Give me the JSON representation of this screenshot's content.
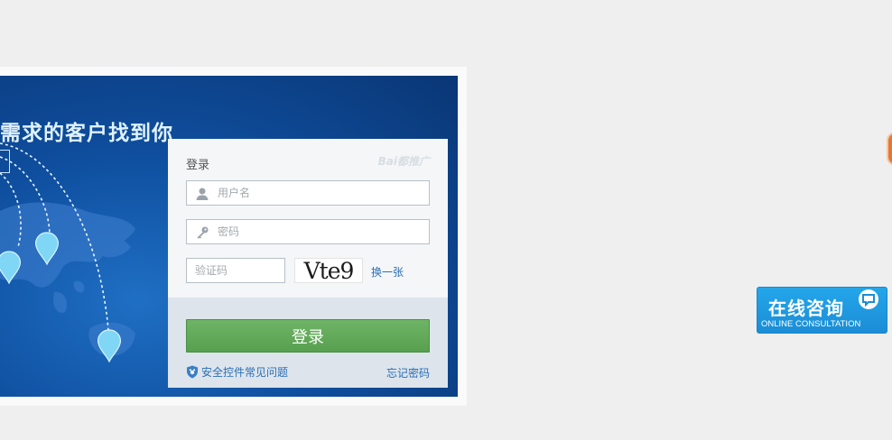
{
  "banner": {
    "headline": "需求的客户找到你"
  },
  "login": {
    "title": "登录",
    "brand": "Bai都推广",
    "username_placeholder": "用户名",
    "password_placeholder": "密码",
    "captcha_placeholder": "验证码",
    "captcha_text": "Vte9",
    "refresh_label": "换一张",
    "submit_label": "登录",
    "security_label": "安全控件常见问题",
    "forgot_label": "忘记密码"
  },
  "consult": {
    "title_cn": "在线咨询",
    "title_en": "ONLINE CONSULTATION"
  },
  "colors": {
    "banner_blue": "#0f4f9f",
    "submit_green": "#5fa857",
    "link_blue": "#2a6fb4",
    "consult_blue": "#1b8dd6"
  },
  "icons": {
    "username": "user-icon",
    "password": "key-icon",
    "security": "shield-icon",
    "consult": "chat-bubble-icon"
  }
}
